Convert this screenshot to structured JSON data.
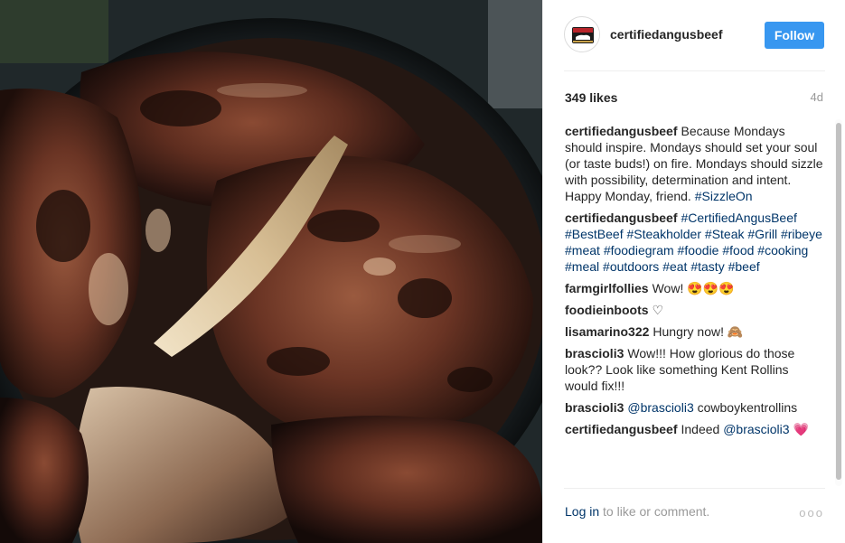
{
  "post": {
    "username": "certifiedangusbeef",
    "follow_label": "Follow",
    "likes": "349 likes",
    "age": "4d",
    "avatar_logo_text": "CERTIFIED ANGUS BEEF"
  },
  "comments": [
    {
      "user": "certifiedangusbeef",
      "segments": [
        {
          "text": "Because Mondays should inspire. Mondays should set your soul (or taste buds!) on fire. Mondays should sizzle with possibility, determination and intent. Happy Monday, friend. "
        },
        {
          "text": "#SizzleOn",
          "tag": true
        }
      ]
    },
    {
      "user": "certifiedangusbeef",
      "segments": [
        {
          "text": "#CertifiedAngusBeef",
          "tag": true
        },
        {
          "text": " "
        },
        {
          "text": "#BestBeef",
          "tag": true
        },
        {
          "text": " "
        },
        {
          "text": "#Steakholder",
          "tag": true
        },
        {
          "text": " "
        },
        {
          "text": "#Steak",
          "tag": true
        },
        {
          "text": " "
        },
        {
          "text": "#Grill",
          "tag": true
        },
        {
          "text": " "
        },
        {
          "text": "#ribeye",
          "tag": true
        },
        {
          "text": " "
        },
        {
          "text": "#meat",
          "tag": true
        },
        {
          "text": " "
        },
        {
          "text": "#foodiegram",
          "tag": true
        },
        {
          "text": " "
        },
        {
          "text": "#foodie",
          "tag": true
        },
        {
          "text": " "
        },
        {
          "text": "#food",
          "tag": true
        },
        {
          "text": " "
        },
        {
          "text": "#cooking",
          "tag": true
        },
        {
          "text": " "
        },
        {
          "text": "#meal",
          "tag": true
        },
        {
          "text": " "
        },
        {
          "text": "#outdoors",
          "tag": true
        },
        {
          "text": " "
        },
        {
          "text": "#eat",
          "tag": true
        },
        {
          "text": " "
        },
        {
          "text": "#tasty",
          "tag": true
        },
        {
          "text": " "
        },
        {
          "text": "#beef",
          "tag": true
        }
      ]
    },
    {
      "user": "farmgirlfollies",
      "segments": [
        {
          "text": "Wow! 😍😍😍"
        }
      ]
    },
    {
      "user": "foodieinboots",
      "segments": [
        {
          "text": "♡"
        }
      ]
    },
    {
      "user": "lisamarino322",
      "segments": [
        {
          "text": "Hungry now! 🙈"
        }
      ]
    },
    {
      "user": "brascioli3",
      "segments": [
        {
          "text": "Wow!!! How glorious do those look?? Look like something Kent Rollins would fix!!!"
        }
      ]
    },
    {
      "user": "brascioli3",
      "segments": [
        {
          "text": "@brascioli3",
          "tag": true
        },
        {
          "text": " cowboykentrollins"
        }
      ]
    },
    {
      "user": "certifiedangusbeef",
      "segments": [
        {
          "text": "Indeed "
        },
        {
          "text": "@brascioli3",
          "tag": true
        },
        {
          "text": " 💗"
        }
      ]
    }
  ],
  "footer": {
    "login_link": "Log in",
    "login_rest": " to like or comment.",
    "more_label": "ooo"
  },
  "colors": {
    "accent": "#3897f0",
    "hashtag": "#003569",
    "muted": "#999999"
  },
  "icons": {
    "avatar": "brand-logo-icon",
    "more": "more-options-icon"
  }
}
